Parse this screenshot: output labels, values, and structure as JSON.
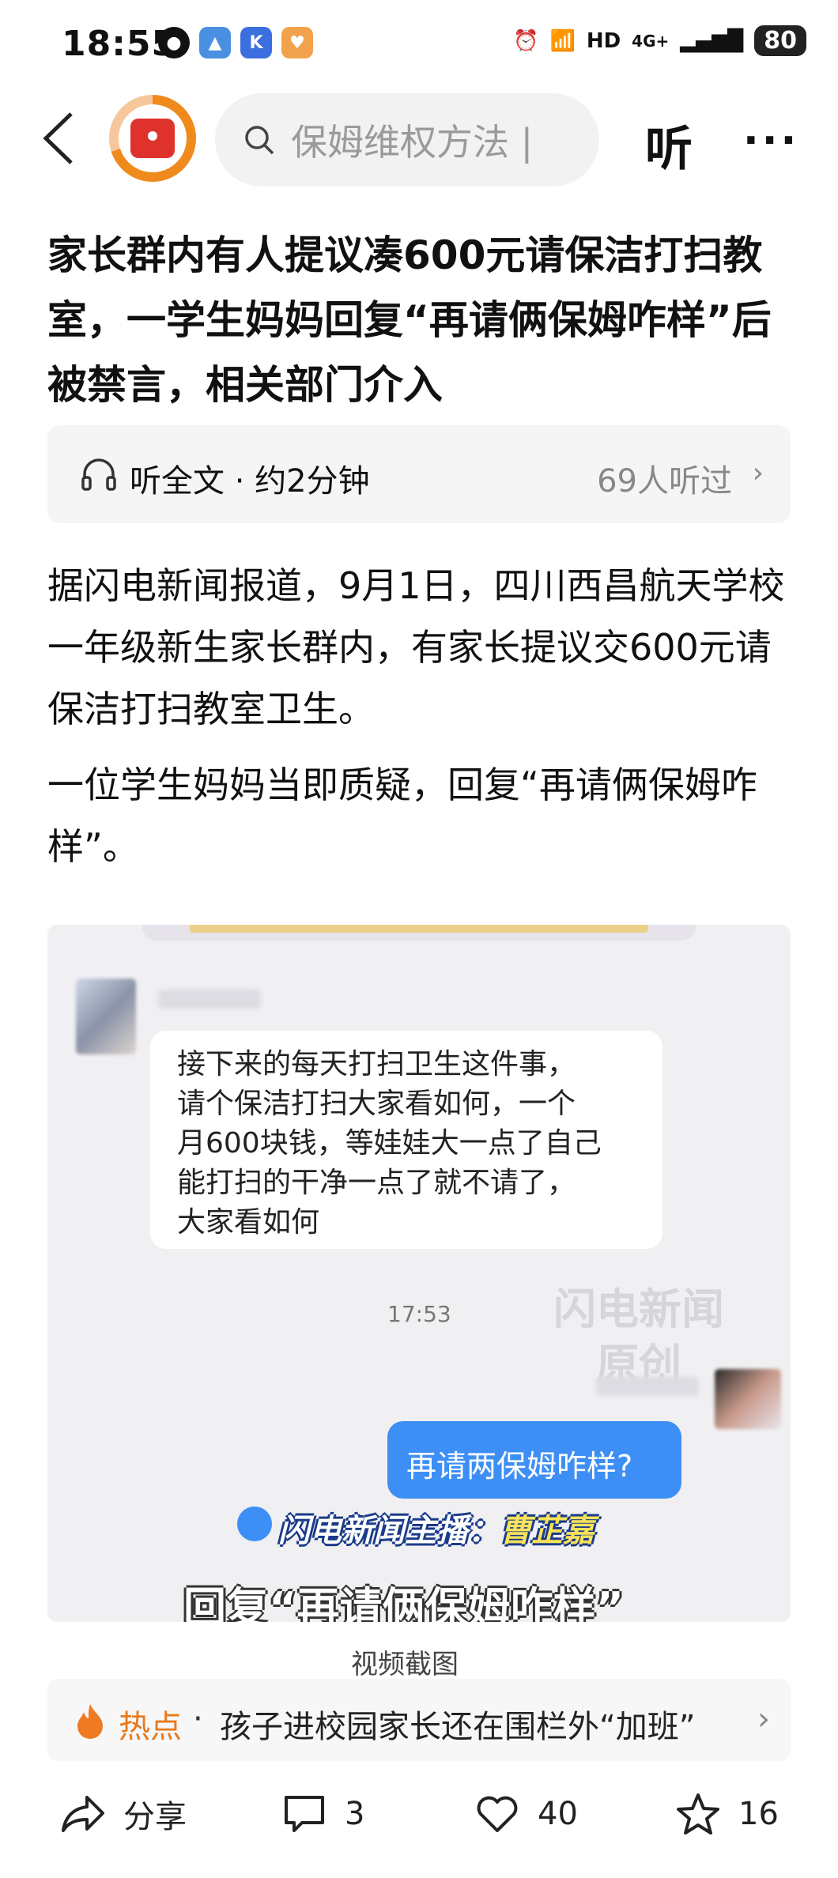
{
  "status_bar": {
    "time": "18:55",
    "network_hd": "HD",
    "network_type": "4G+",
    "battery": "80"
  },
  "nav": {
    "search_placeholder": "保姆维权方法 | ",
    "listen_label": "听",
    "more_label": "···"
  },
  "article": {
    "headline": "家长群内有人提议凑600元请保洁打扫教室，一学生妈妈回复“再请俩保姆咋样”后被禁言，相关部门介入",
    "listen_bar": {
      "text": "听全文 · 约2分钟",
      "count": "69人听过"
    },
    "paragraphs": [
      "据闪电新闻报道，9月1日，四川西昌航天学校一年级新生家长群内，有家长提议交600元请保洁打扫教室卫生。",
      "一位学生妈妈当即质疑，回复“再请俩保姆咋样”。"
    ],
    "image": {
      "left_message": "接下来的每天打扫卫生这件事，\n请个保洁打扫大家看如何，一个\n月600块钱，等娃娃大一点了自己\n能打扫的干净一点了就不请了，\n大家看如何",
      "time": "17:53",
      "watermark": "闪电新闻\n原创",
      "right_message": "再请两保姆咋样?",
      "anchor_prefix": "闪电新闻主播：",
      "anchor_name": "曹芷嘉",
      "caption": "回复“再请俩保姆咋样”"
    },
    "image_caption": "视频截图"
  },
  "hot": {
    "label": "热点",
    "dot": "·",
    "text": "孩子进校园家长还在围栏外“加班”"
  },
  "actions": {
    "share": "分享",
    "comments": "3",
    "likes": "40",
    "favorites": "16"
  },
  "colors": {
    "accent_orange": "#e67a1c",
    "chat_blue": "#3d8ff5",
    "brand_red": "#e0322c"
  }
}
